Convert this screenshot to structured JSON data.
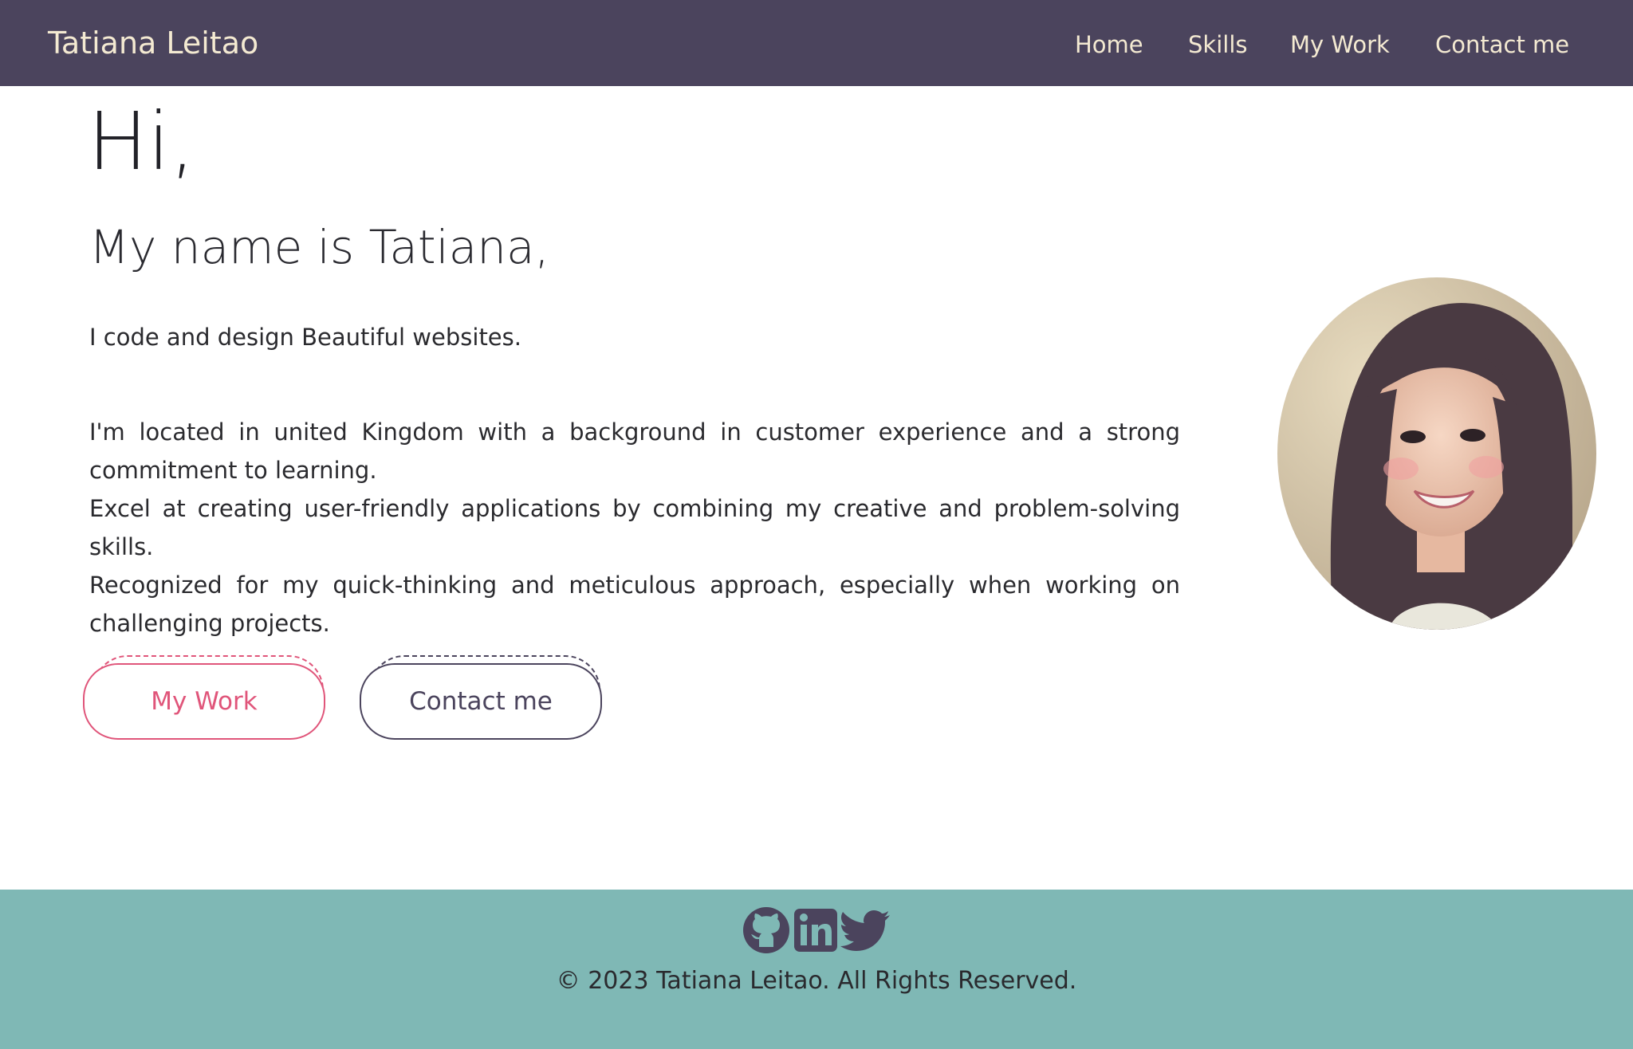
{
  "header": {
    "brand": "Tatiana Leitao",
    "nav": [
      "Home",
      "Skills",
      "My Work",
      "Contact me"
    ]
  },
  "hero": {
    "greeting": "Hi,",
    "name_line": "My name is Tatiana,",
    "tagline": "I code and design Beautiful websites.",
    "bio": [
      "I'm located in united Kingdom with a background in customer experience and a strong commitment to learning.",
      "Excel at creating user-friendly applications by combining my creative and problem-solving skills.",
      "Recognized for my quick-thinking and meticulous approach, especially when working on challenging projects."
    ],
    "buttons": {
      "my_work": "My Work",
      "contact": "Contact me"
    },
    "portrait_icon": "avatar-portrait"
  },
  "footer": {
    "social_icons": [
      "github-icon",
      "linkedin-icon",
      "twitter-icon"
    ],
    "copyright": "© 2023 Tatiana Leitao. All Rights Reserved."
  },
  "colors": {
    "navbar_bg": "#4b445d",
    "nav_text": "#f4ead2",
    "accent_pink": "#e0557a",
    "accent_dark": "#4b445d",
    "footer_bg": "#7fb8b5"
  }
}
